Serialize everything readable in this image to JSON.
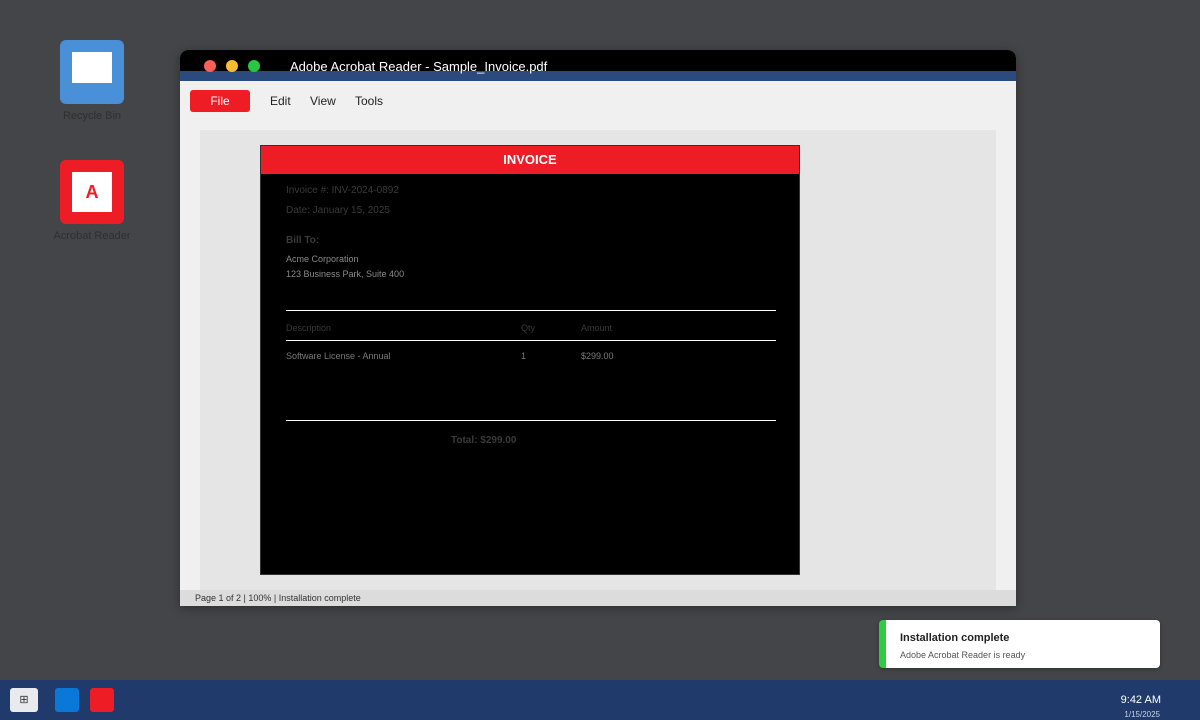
{
  "desktop": {
    "icons": [
      {
        "label": "Recycle Bin"
      },
      {
        "label": "Acrobat Reader",
        "glyph": "A"
      }
    ]
  },
  "window": {
    "title": "Adobe Acrobat Reader - Sample_Invoice.pdf",
    "menu": {
      "file": "File",
      "edit": "Edit",
      "view": "View",
      "tools": "Tools"
    },
    "status": "Page 1 of 2 | 100% | Installation complete"
  },
  "document": {
    "header": "INVOICE",
    "invoice_number": "Invoice #: INV-2024-0892",
    "date": "Date: January 15, 2025",
    "bill_to_label": "Bill To:",
    "bill_to_name": "Acme Corporation",
    "bill_to_address": "123 Business Park, Suite 400",
    "table": {
      "headers": [
        "Description",
        "Qty",
        "Amount"
      ],
      "rows": [
        [
          "Software License - Annual",
          "1",
          "$299.00"
        ]
      ]
    },
    "total": "Total: $299.00"
  },
  "toast": {
    "title": "Installation complete",
    "body": "Adobe Acrobat Reader is ready",
    "accent": "#2ecc40"
  },
  "taskbar": {
    "start_glyph": "⊞",
    "time": "9:42 AM",
    "date": "1/15/2025"
  },
  "colors": {
    "brand_red": "#ee1c25",
    "taskbar_blue": "#1f3a6b",
    "desktop_bg": "#444548"
  }
}
